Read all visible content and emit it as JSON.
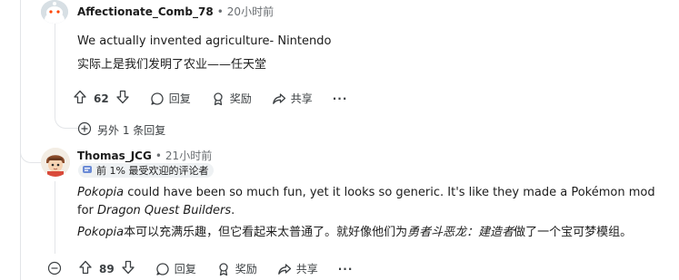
{
  "comments": [
    {
      "username": "Affectionate_Comb_78",
      "separator": "•",
      "time": "20小时前",
      "lines": [
        "We actually invented agriculture- Nintendo",
        "实际上是我们发明了农业——任天堂"
      ],
      "actions": {
        "vote_count": "62",
        "reply_label": "回复",
        "award_label": "奖励",
        "share_label": "共享",
        "more_label": "···"
      },
      "more_replies": "另外 1 条回复"
    },
    {
      "username": "Thomas_JCG",
      "separator": "•",
      "time": "21小时前",
      "badge": "前 1% 最受欢迎的评论者",
      "en_parts": {
        "italic1": "Pokopia",
        "mid": " could have been so much fun, yet it looks so generic. It's like they made a Pokémon mod for ",
        "italic2": "Dragon Quest Builders",
        "end": "."
      },
      "zh_parts": {
        "italic1": "Pokopia",
        "mid": "本可以充满乐趣，但它看起来太普通了。就好像他们为",
        "italic2": "勇者斗恶龙：建造者",
        "end": "做了一个宝可梦模组。"
      },
      "actions": {
        "vote_count": "89",
        "reply_label": "回复",
        "award_label": "奖励",
        "share_label": "共享",
        "more_label": "···"
      }
    }
  ],
  "colors": {
    "text": "#1c1c1c",
    "muted": "#6a6e72",
    "thread_line": "#e3e5e8",
    "badge_bg": "#eef1f3"
  }
}
